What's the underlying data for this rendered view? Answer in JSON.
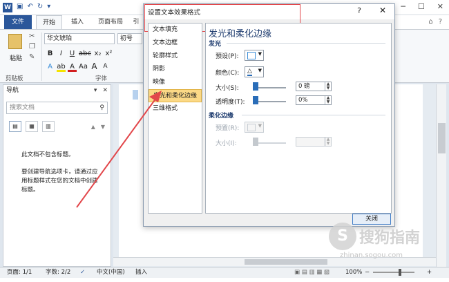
{
  "titlebar": {
    "app_icon": "W",
    "save_icon": "save-icon",
    "undo_icon": "↶",
    "redo_icon": "↻",
    "qat_more": "▾",
    "controls": {
      "min": "─",
      "max": "☐",
      "close": "✕"
    }
  },
  "tabs": {
    "file": "文件",
    "home": "开始",
    "insert": "插入",
    "layout": "页面布局",
    "more": "引"
  },
  "tabrow_right": {
    "collapse": "⌂",
    "help": "?"
  },
  "ribbon": {
    "paste_label": "粘贴",
    "clipboard_label": "剪贴板",
    "font_name": "华文琥珀",
    "font_size": "初号",
    "bold": "B",
    "italic": "I",
    "underline": "U",
    "strike": "abc",
    "sub": "x₂",
    "sup": "x²",
    "text_effect": "A",
    "highlight": "ab",
    "font_color": "A",
    "aa": "Aa",
    "grow": "A",
    "shrink": "A",
    "font_group_label": "字体"
  },
  "nav": {
    "title": "导航",
    "search_placeholder": "搜索文档",
    "search_icon": "⚲",
    "msg_no_headings": "此文档不包含标题。",
    "msg_hint": "要创建导航选项卡，请通过应用标题样式在您的文档中创建标题。"
  },
  "dialog": {
    "title": "设置文本效果格式",
    "help": "?",
    "close": "✕",
    "categories": [
      "文本填充",
      "文本边框",
      "轮廓样式",
      "阴影",
      "映像",
      "发光和柔化边缘",
      "三维格式"
    ],
    "selected_index": 5,
    "panel_title": "发光和柔化边缘",
    "glow_section": "发光",
    "preset_label": "预设(P):",
    "color_label": "颜色(C):",
    "size_label": "大小(S):",
    "size_value": "0 磅",
    "transparency_label": "透明度(T):",
    "transparency_value": "0%",
    "soft_section": "柔化边缘",
    "soft_preset_label": "预置(R):",
    "soft_size_label": "大小(I):",
    "close_button": "关闭"
  },
  "status": {
    "page": "页面: 1/1",
    "words": "字数: 2/2",
    "language": "中文(中国)",
    "mode": "插入",
    "zoom": "100%",
    "minus": "−",
    "plus": "+"
  },
  "watermark": {
    "logo": "S",
    "text": "搜狗指南",
    "url": "zhinan.sogou.com"
  },
  "colors": {
    "accent": "#2b579a",
    "annotation": "#e2464a",
    "selected_category": "#fbd986"
  }
}
